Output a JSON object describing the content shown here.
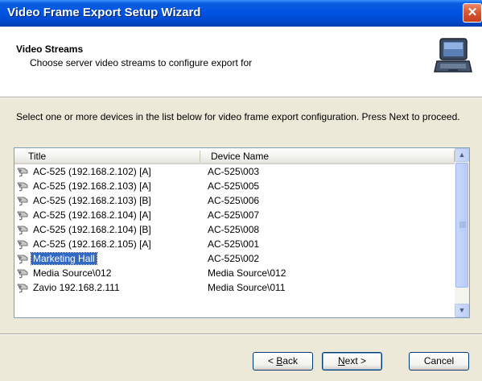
{
  "window": {
    "title": "Video Frame Export Setup Wizard",
    "close_glyph": "✕"
  },
  "header": {
    "title": "Video Streams",
    "subtitle": "Choose server video streams to configure export for",
    "icon": "laptop-icon"
  },
  "instructions": "Select one or more devices in the list below for video frame export configuration. Press Next to proceed.",
  "list": {
    "columns": [
      "Title",
      "Device Name"
    ],
    "rows": [
      {
        "title": "AC-525 (192.168.2.102) [A]",
        "device": "AC-525\\003",
        "selected": false
      },
      {
        "title": "AC-525 (192.168.2.103) [A]",
        "device": "AC-525\\005",
        "selected": false
      },
      {
        "title": "AC-525 (192.168.2.103) [B]",
        "device": "AC-525\\006",
        "selected": false
      },
      {
        "title": "AC-525 (192.168.2.104) [A]",
        "device": "AC-525\\007",
        "selected": false
      },
      {
        "title": "AC-525 (192.168.2.104) [B]",
        "device": "AC-525\\008",
        "selected": false
      },
      {
        "title": "AC-525 (192.168.2.105) [A]",
        "device": "AC-525\\001",
        "selected": false
      },
      {
        "title": "Marketing Hall",
        "device": "AC-525\\002",
        "selected": true
      },
      {
        "title": "Media Source\\012",
        "device": "Media Source\\012",
        "selected": false
      },
      {
        "title": "Zavio 192.168.2.111",
        "device": "Media Source\\011",
        "selected": false
      }
    ],
    "row_icon": "camera-icon"
  },
  "buttons": {
    "back": {
      "prefix": "< ",
      "mnemonic": "B",
      "rest": "ack"
    },
    "next": {
      "mnemonic": "N",
      "rest": "ext >"
    },
    "cancel": "Cancel"
  },
  "colors": {
    "titlebar": "#0054e3",
    "selection": "#316ac5",
    "face": "#ece9d8"
  }
}
